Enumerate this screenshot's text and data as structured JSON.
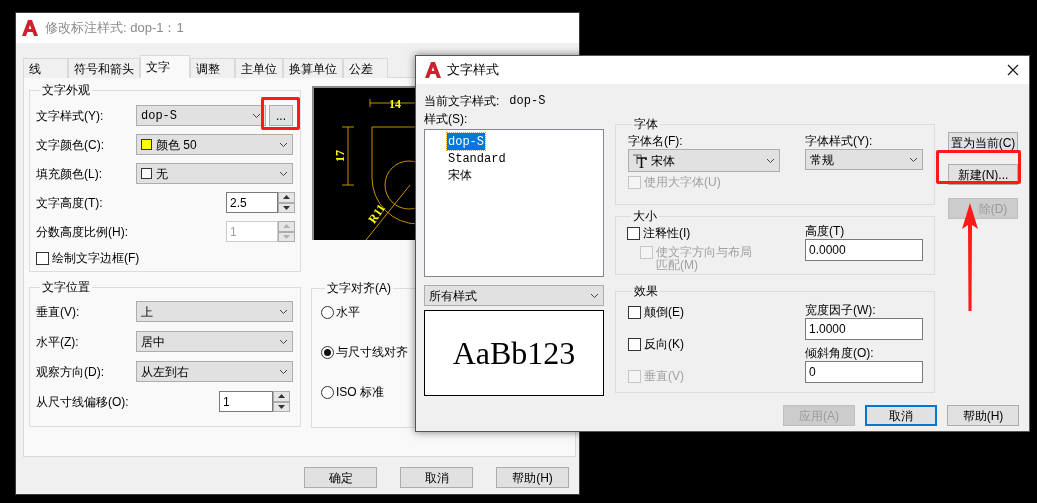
{
  "dimension_style_dialog": {
    "title": "修改标注样式: dop-1：1",
    "tabs": [
      {
        "label": "线",
        "selected": false
      },
      {
        "label": "符号和箭头",
        "selected": false
      },
      {
        "label": "文字",
        "selected": true
      },
      {
        "label": "调整",
        "selected": false
      },
      {
        "label": "主单位",
        "selected": false
      },
      {
        "label": "换算单位",
        "selected": false
      },
      {
        "label": "公差",
        "selected": false
      }
    ],
    "text_appearance": {
      "title": "文字外观",
      "text_style": {
        "label": "文字样式(Y):",
        "value": "dop-S",
        "button": "..."
      },
      "text_color": {
        "label": "文字颜色(C):",
        "value": "颜色 50",
        "color": "#ffff00"
      },
      "fill_color": {
        "label": "填充颜色(L):",
        "value": "无",
        "color": "#ffffff"
      },
      "text_height": {
        "label": "文字高度(T):",
        "value": "2.5",
        "disabled": false
      },
      "fraction_scale": {
        "label": "分数高度比例(H):",
        "value": "1",
        "disabled": true
      },
      "draw_frame": {
        "label": "绘制文字边框(F)",
        "checked": false
      }
    },
    "preview": {
      "labels": [
        "14",
        "17",
        "R11"
      ]
    },
    "text_placement": {
      "title": "文字位置",
      "vertical": {
        "label": "垂直(V):",
        "value": "上"
      },
      "horizontal": {
        "label": "水平(Z):",
        "value": "居中"
      },
      "view_direction": {
        "label": "观察方向(D):",
        "value": "从左到右"
      },
      "offset": {
        "label": "从尺寸线偏移(O):",
        "value": "1"
      }
    },
    "text_alignment": {
      "title": "文字对齐(A)",
      "options": [
        {
          "label": "水平",
          "selected": false
        },
        {
          "label": "与尺寸线对齐",
          "selected": true
        },
        {
          "label": "ISO 标准",
          "selected": false
        }
      ]
    },
    "buttons": [
      "确定",
      "取消",
      "帮助(H)"
    ]
  },
  "text_style_dialog": {
    "title": "文字样式",
    "current_style": {
      "label": "当前文字样式:",
      "value": "dop-S"
    },
    "styles_label": "样式(S):",
    "styles": [
      {
        "label": "dop-S",
        "selected": true
      },
      {
        "label": "Standard",
        "selected": false
      },
      {
        "label": "宋体",
        "selected": false
      }
    ],
    "filter": "所有样式",
    "sample": "AaBb123",
    "font": {
      "title": "字体",
      "font_name": {
        "label": "字体名(F):",
        "value": "宋体"
      },
      "font_style": {
        "label": "字体样式(Y):",
        "value": "常规"
      },
      "big_font": {
        "label": "使用大字体(U)",
        "checked": false,
        "disabled": true
      }
    },
    "size": {
      "title": "大小",
      "annotative": {
        "label": "注释性(I)",
        "checked": false,
        "disabled": false
      },
      "match_layout": {
        "label": "使文字方向与布局匹配(M)",
        "checked": false,
        "disabled": true
      },
      "height": {
        "label": "高度(T)",
        "value": "0.0000"
      }
    },
    "effects": {
      "title": "效果",
      "options": [
        {
          "label": "颠倒(E)",
          "checked": false,
          "disabled": false
        },
        {
          "label": "反向(K)",
          "checked": false,
          "disabled": false
        },
        {
          "label": "垂直(V)",
          "checked": false,
          "disabled": true
        }
      ],
      "width_factor": {
        "label": "宽度因子(W):",
        "value": "1.0000"
      },
      "oblique_angle": {
        "label": "倾斜角度(O):",
        "value": "0"
      }
    },
    "side_buttons": [
      {
        "label": "置为当前(C)",
        "disabled": false
      },
      {
        "label": "新建(N)...",
        "disabled": false
      },
      {
        "label": "除(D)",
        "disabled": true
      }
    ],
    "buttons": [
      {
        "label": "应用(A)",
        "disabled": true,
        "focused": false
      },
      {
        "label": "取消",
        "disabled": false,
        "focused": true
      },
      {
        "label": "帮助(H)",
        "disabled": false,
        "focused": false
      }
    ]
  }
}
